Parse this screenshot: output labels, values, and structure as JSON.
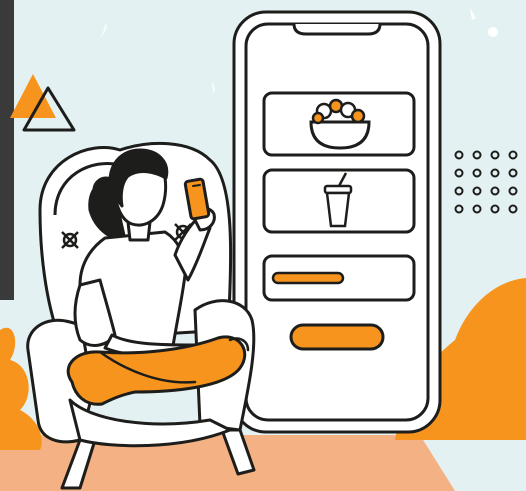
{
  "scene": {
    "palette": {
      "background": "#e4f1f2",
      "accent_orange": "#f7941d",
      "outline": "#1d1d1b",
      "skin": "#ffffff",
      "floor": "#f4b183",
      "hair": "#1d1d1b",
      "dark_panel": "#3a3a3a"
    },
    "phone_mockup": {
      "cards": [
        {
          "icon": "salad-bowl-icon"
        },
        {
          "icon": "drink-cup-icon"
        },
        {
          "icon": "progress-bar",
          "fill_fraction": 0.5
        }
      ],
      "button": {
        "icon": "pill-button"
      }
    },
    "decorations": [
      "triangle-icon",
      "dot-grid",
      "orange-bush",
      "sparkles"
    ],
    "person": {
      "pose": "sitting-in-armchair",
      "holding": "smartphone"
    }
  }
}
